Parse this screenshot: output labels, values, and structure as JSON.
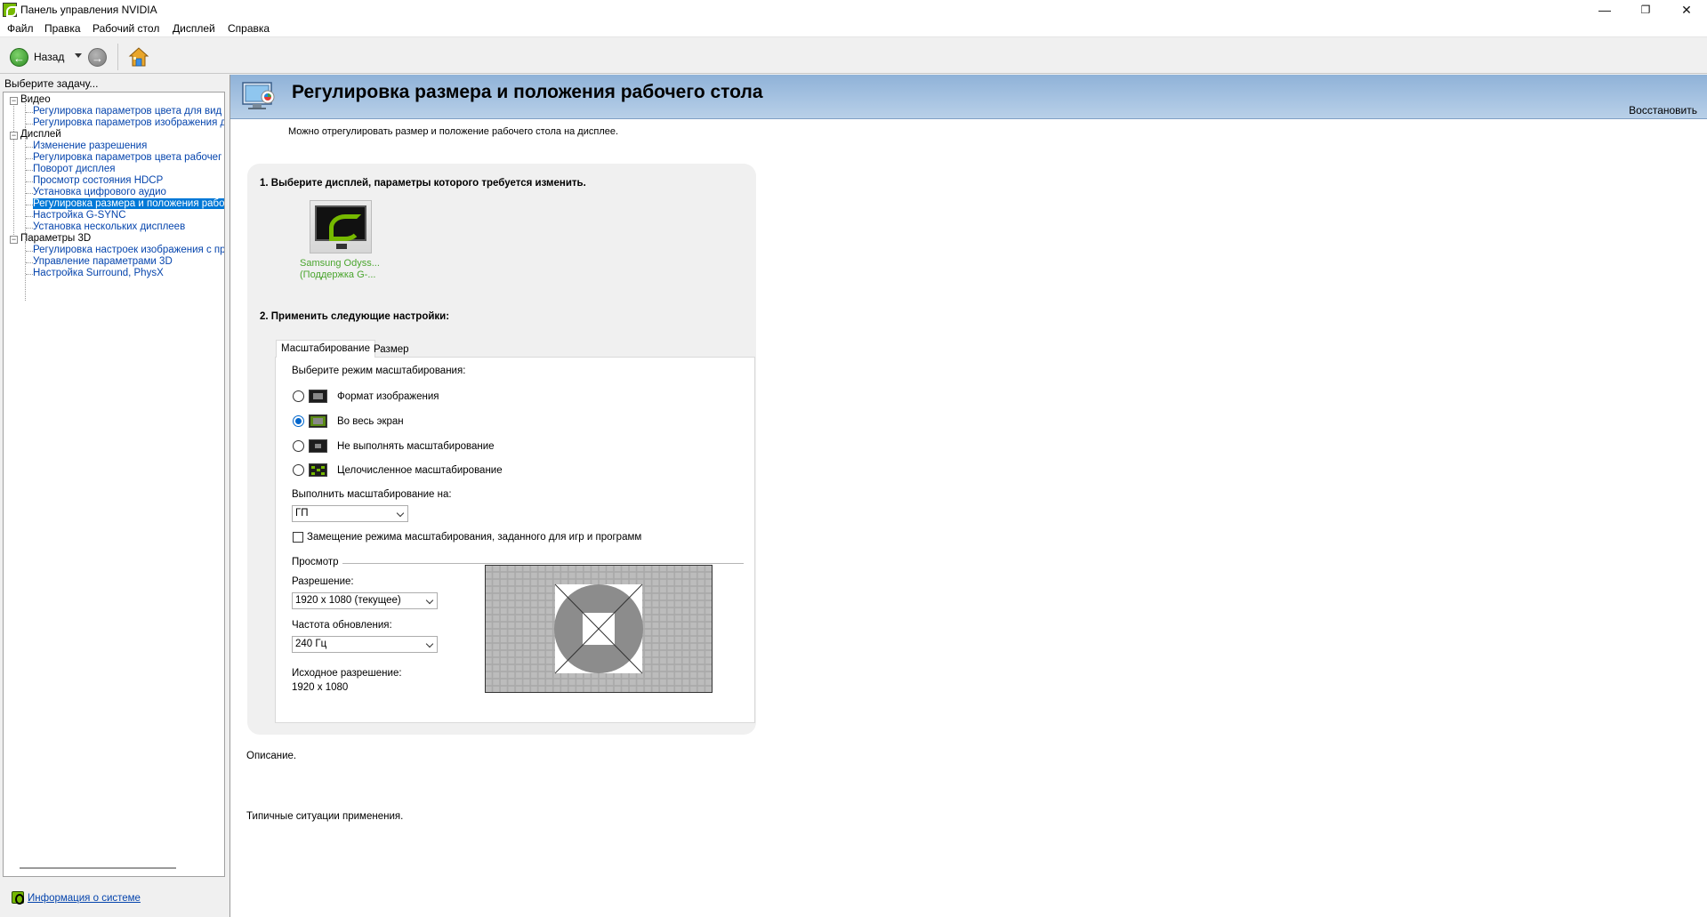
{
  "window": {
    "title": "Панель управления NVIDIA",
    "controls": {
      "minimize": "—",
      "maximize": "❐",
      "close": "✕"
    }
  },
  "menu": {
    "items": [
      "Файл",
      "Правка",
      "Рабочий стол",
      "Дисплей",
      "Справка"
    ]
  },
  "toolbar": {
    "back_label": "Назад"
  },
  "left": {
    "header": "Выберите задачу...",
    "tree": [
      {
        "label": "Видео",
        "type": "category"
      },
      {
        "label": "Регулировка параметров цвета для вид",
        "type": "link"
      },
      {
        "label": "Регулировка параметров изображения д",
        "type": "link"
      },
      {
        "label": "Дисплей",
        "type": "category"
      },
      {
        "label": "Изменение разрешения",
        "type": "link"
      },
      {
        "label": "Регулировка параметров цвета рабочег",
        "type": "link"
      },
      {
        "label": "Поворот дисплея",
        "type": "link"
      },
      {
        "label": "Просмотр состояния HDCP",
        "type": "link"
      },
      {
        "label": "Установка цифрового аудио",
        "type": "link"
      },
      {
        "label": "Регулировка размера и положения рабо",
        "type": "link",
        "selected": true
      },
      {
        "label": "Настройка G-SYNC",
        "type": "link"
      },
      {
        "label": "Установка нескольких дисплеев",
        "type": "link"
      },
      {
        "label": "Параметры 3D",
        "type": "category"
      },
      {
        "label": "Регулировка настроек изображения с пр",
        "type": "link"
      },
      {
        "label": "Управление параметрами 3D",
        "type": "link"
      },
      {
        "label": "Настройка Surround, PhysX",
        "type": "link"
      }
    ],
    "system_info_link": "Информация о системе"
  },
  "page": {
    "title": "Регулировка размера и положения рабочего стола",
    "restore": "Восстановить",
    "intro": "Можно отрегулировать размер и положение рабочего стола на дисплее.",
    "step1": "1. Выберите дисплей, параметры которого требуется изменить.",
    "display_name_line1": "Samsung Odyss...",
    "display_name_line2": "(Поддержка G-...",
    "step2": "2. Применить следующие настройки:",
    "tabs": [
      "Масштабирование",
      "Размер"
    ],
    "scaling": {
      "prompt": "Выберите режим масштабирования:",
      "modes": [
        "Формат изображения",
        "Во весь экран",
        "Не выполнять масштабирование",
        "Целочисленное масштабирование"
      ],
      "selected_index": 1,
      "perform_on_label": "Выполнить масштабирование на:",
      "perform_on_value": "ГП",
      "override_label": "Замещение режима масштабирования, заданного для игр и программ",
      "override_checked": false
    },
    "preview": {
      "title": "Просмотр",
      "resolution_label": "Разрешение:",
      "resolution_value": "1920 x 1080 (текущее)",
      "refresh_label": "Частота обновления:",
      "refresh_value": "240 Гц",
      "native_label": "Исходное разрешение:",
      "native_value": "1920 x 1080"
    },
    "description_label": "Описание.",
    "typical_label": "Типичные ситуации применения."
  },
  "colors": {
    "nvidia_green": "#76b900",
    "link_blue": "#0645ad",
    "selection_blue": "#0078d7",
    "banner_blue": "#a8c4e2"
  }
}
